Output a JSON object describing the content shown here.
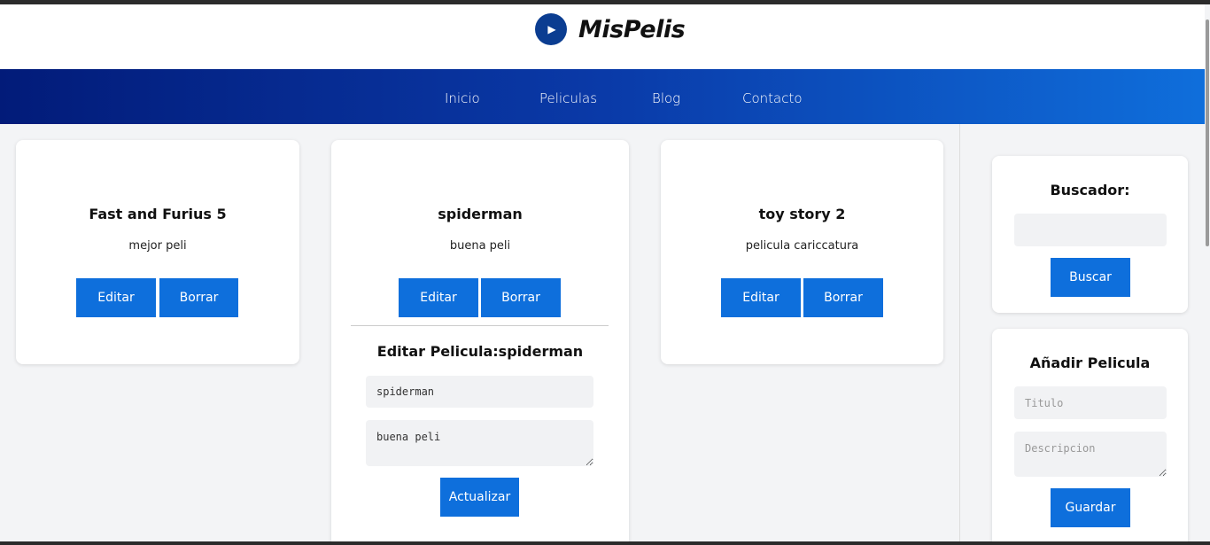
{
  "brand": {
    "name": "MisPelis",
    "icon": "play-icon"
  },
  "nav": {
    "items": [
      "Inicio",
      "Peliculas",
      "Blog",
      "Contacto"
    ]
  },
  "movies": [
    {
      "title": "Fast and Furius 5",
      "description": "mejor peli",
      "edit_label": "Editar",
      "delete_label": "Borrar"
    },
    {
      "title": "spiderman",
      "description": "buena peli",
      "edit_label": "Editar",
      "delete_label": "Borrar"
    },
    {
      "title": "toy story 2",
      "description": "pelicula cariccatura",
      "edit_label": "Editar",
      "delete_label": "Borrar"
    }
  ],
  "edit_form": {
    "title": "Editar Pelicula:spiderman",
    "title_value": "spiderman",
    "description_value": "buena peli",
    "submit_label": "Actualizar"
  },
  "search": {
    "title": "Buscador:",
    "value": "",
    "button_label": "Buscar"
  },
  "add_form": {
    "title": "Añadir Pelicula",
    "title_placeholder": "Titulo",
    "description_placeholder": "Descripcion",
    "submit_label": "Guardar"
  },
  "colors": {
    "accent": "#0e6fdc",
    "nav_start": "#021b79",
    "nav_end": "#0f6fdc"
  }
}
